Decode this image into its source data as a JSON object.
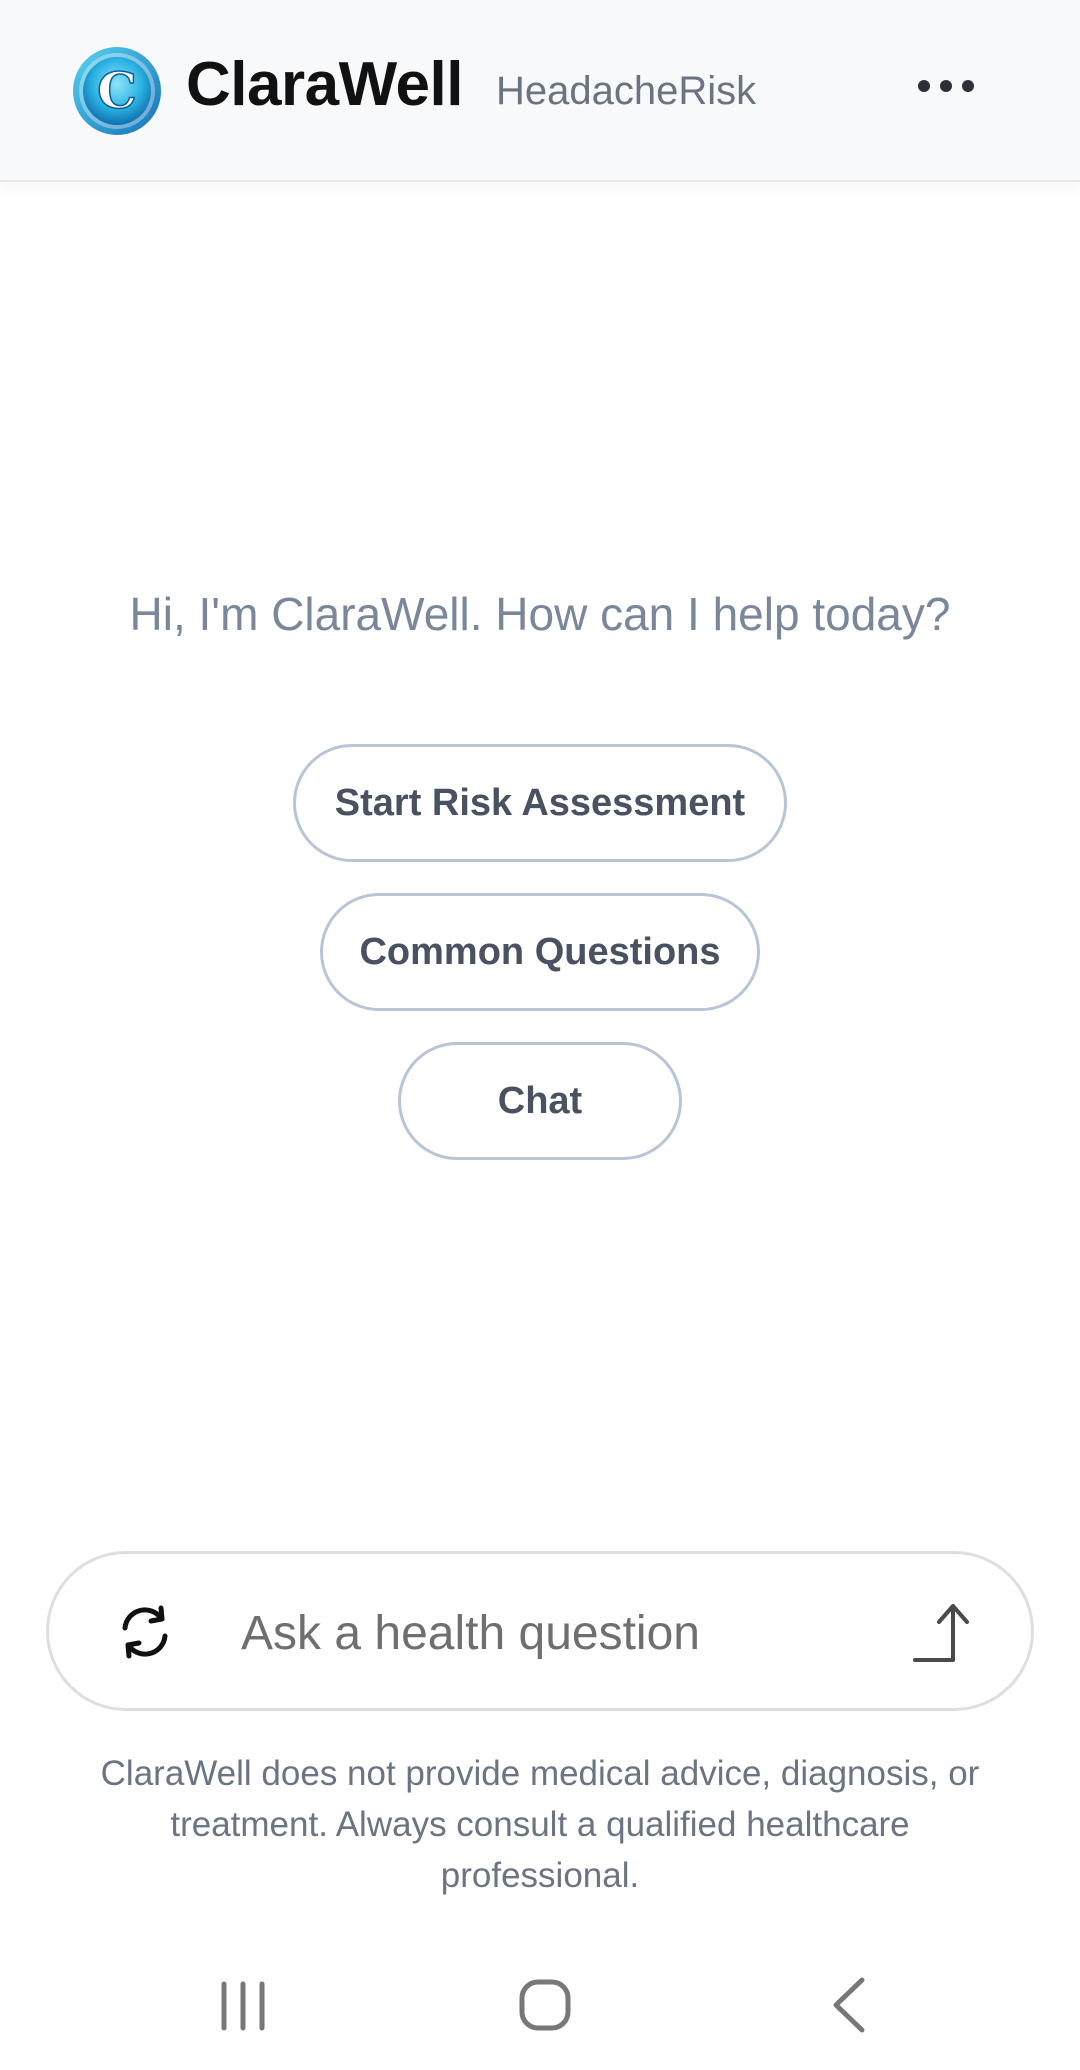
{
  "header": {
    "brand": "ClaraWell",
    "subtitle": "HeadacheRisk",
    "logo_letter": "C",
    "more_icon": "more-horizontal-icon"
  },
  "main": {
    "greeting": "Hi, I'm ClaraWell. How can I help today?",
    "actions": [
      {
        "label": "Start Risk Assessment"
      },
      {
        "label": "Common Questions"
      },
      {
        "label": "Chat"
      }
    ]
  },
  "composer": {
    "placeholder": "Ask a health question",
    "refresh_icon": "refresh-icon",
    "send_icon": "send-arrow-icon"
  },
  "disclaimer": "ClaraWell does not provide medical advice, diagnosis, or treatment. Always consult a qualified healthcare professional.",
  "system_nav": {
    "recents_icon": "recents-icon",
    "home_icon": "home-icon",
    "back_icon": "back-icon"
  },
  "colors": {
    "brand_text": "#111111",
    "muted_text": "#7a8699",
    "pill_border": "#b7c5d6",
    "logo_blue": "#1e9fd8"
  }
}
